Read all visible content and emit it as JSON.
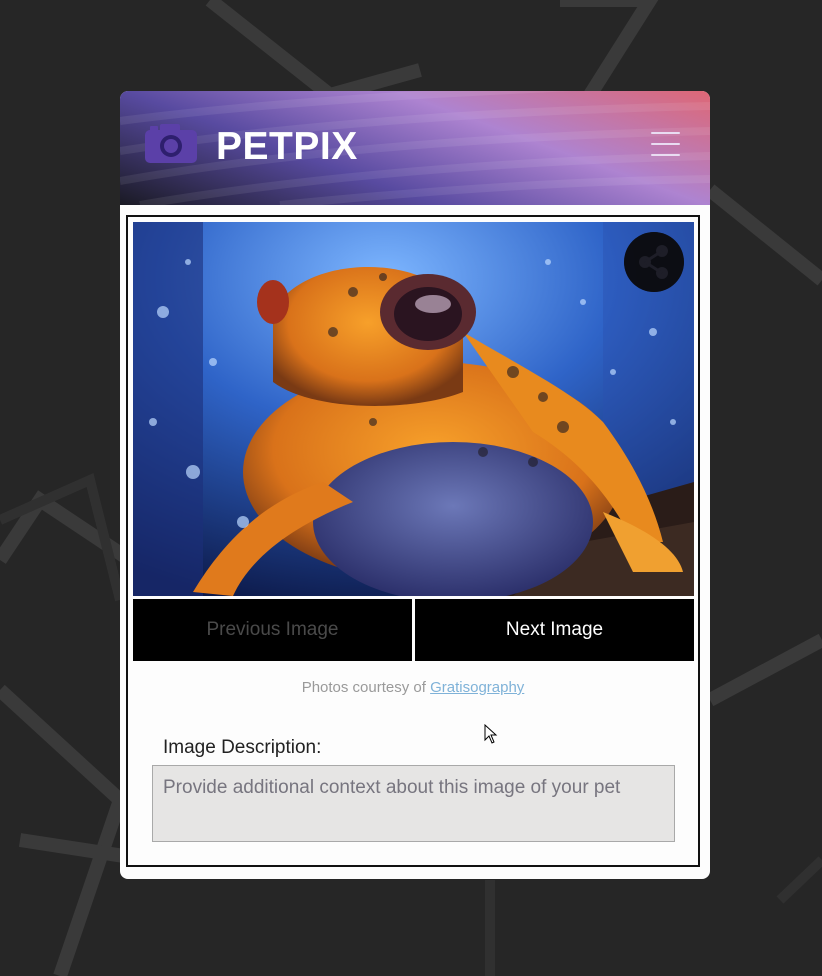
{
  "app": {
    "brand": "PETPIX",
    "colors": {
      "page_background": "#262626",
      "header_gradient_start": "#dc5f6e",
      "header_gradient_mid": "#6a4fb0",
      "header_dark": "#1a1a24",
      "logo_icon": "#5b40a8",
      "link": "#7fb2d8"
    }
  },
  "header": {
    "logo_icon": "camera-icon",
    "menu_icon": "hamburger-menu-icon"
  },
  "gallery": {
    "image_alt": "Orange frog with blue spots",
    "share_icon": "share-icon",
    "prev_label": "Previous Image",
    "next_label": "Next Image",
    "credit_prefix": "Photos courtesy of ",
    "credit_link": "Gratisography"
  },
  "description": {
    "label": "Image Description:",
    "placeholder": "Provide additional context about this image of your pet",
    "value": ""
  }
}
